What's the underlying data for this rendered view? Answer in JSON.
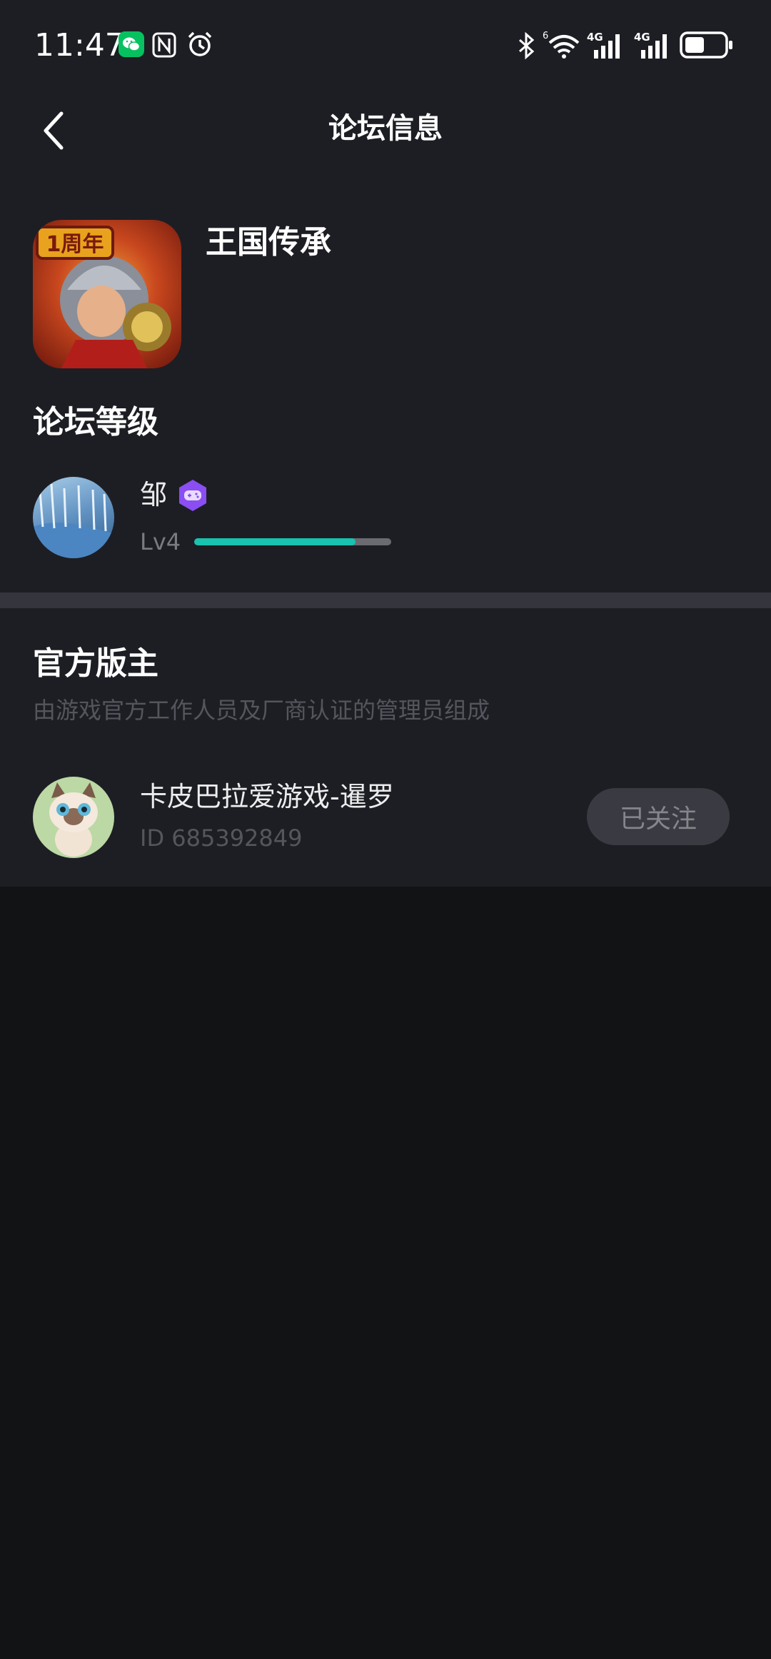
{
  "status_bar": {
    "time": "11:47",
    "icons": [
      "wechat-icon",
      "nfc-icon",
      "alarm-icon",
      "bluetooth-icon",
      "wifi-icon",
      "signal-4g-icon",
      "signal-4g-icon",
      "battery-icon"
    ],
    "wifi_badge": "6",
    "signal_label": "4G",
    "battery_level": 0.5
  },
  "header": {
    "back_icon": "chevron-left-icon",
    "title": "论坛信息"
  },
  "game": {
    "name": "王国传承",
    "icon_badge": "1周年"
  },
  "forum_level": {
    "section_title": "论坛等级",
    "user_name": "邹",
    "badge_icon": "gamepad-icon",
    "level_label": "Lv4",
    "progress": 0.82
  },
  "moderators": {
    "section_title": "官方版主",
    "subtitle": "由游戏官方工作人员及厂商认证的管理员组成",
    "items": [
      {
        "name": "卡皮巴拉爱游戏-暹罗",
        "id_text": "ID 685392849",
        "follow_label": "已关注"
      }
    ]
  },
  "colors": {
    "panel_bg": "#1d1e24",
    "page_bg": "#111314",
    "accent": "#18c3b0",
    "badge_purple": "#8a4ef2"
  }
}
